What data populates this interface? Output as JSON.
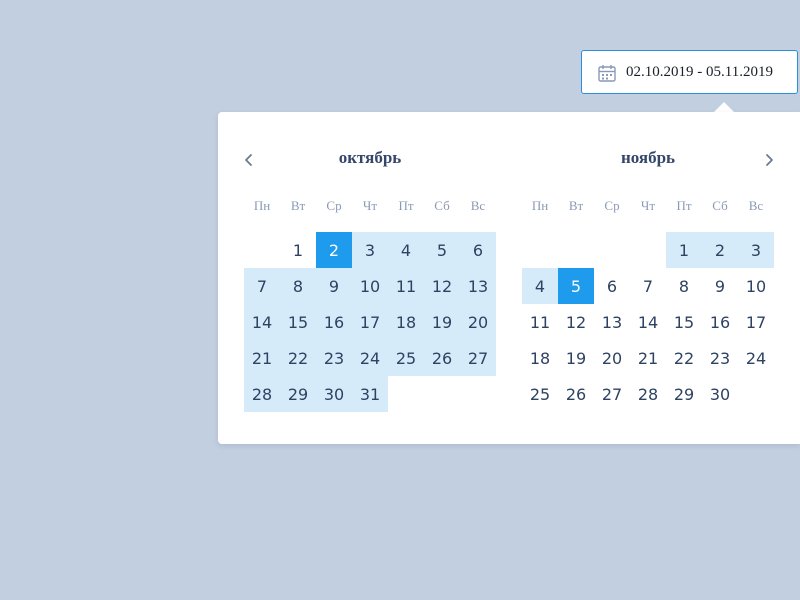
{
  "date_input": {
    "value": "02.10.2019 - 05.11.2019",
    "icon": "calendar-icon"
  },
  "colors": {
    "background": "#c2cfe0",
    "selected": "#1e9bec",
    "range": "#d6ebfa",
    "text": "#2e4262",
    "weekday": "#8a99b6"
  },
  "nav": {
    "prev_icon": "chevron-left-icon",
    "next_icon": "chevron-right-icon"
  },
  "weekdays": [
    "Пн",
    "Вт",
    "Ср",
    "Чт",
    "Пт",
    "Сб",
    "Вс"
  ],
  "months": [
    {
      "title": "октябрь",
      "leading_blanks": 1,
      "days_in_month": 31,
      "range_days": [
        2,
        3,
        4,
        5,
        6,
        7,
        8,
        9,
        10,
        11,
        12,
        13,
        14,
        15,
        16,
        17,
        18,
        19,
        20,
        21,
        22,
        23,
        24,
        25,
        26,
        27,
        28,
        29,
        30,
        31
      ],
      "selected_days": [
        2
      ]
    },
    {
      "title": "ноябрь",
      "leading_blanks": 4,
      "days_in_month": 30,
      "range_days": [
        1,
        2,
        3,
        4,
        5
      ],
      "selected_days": [
        5
      ]
    }
  ]
}
